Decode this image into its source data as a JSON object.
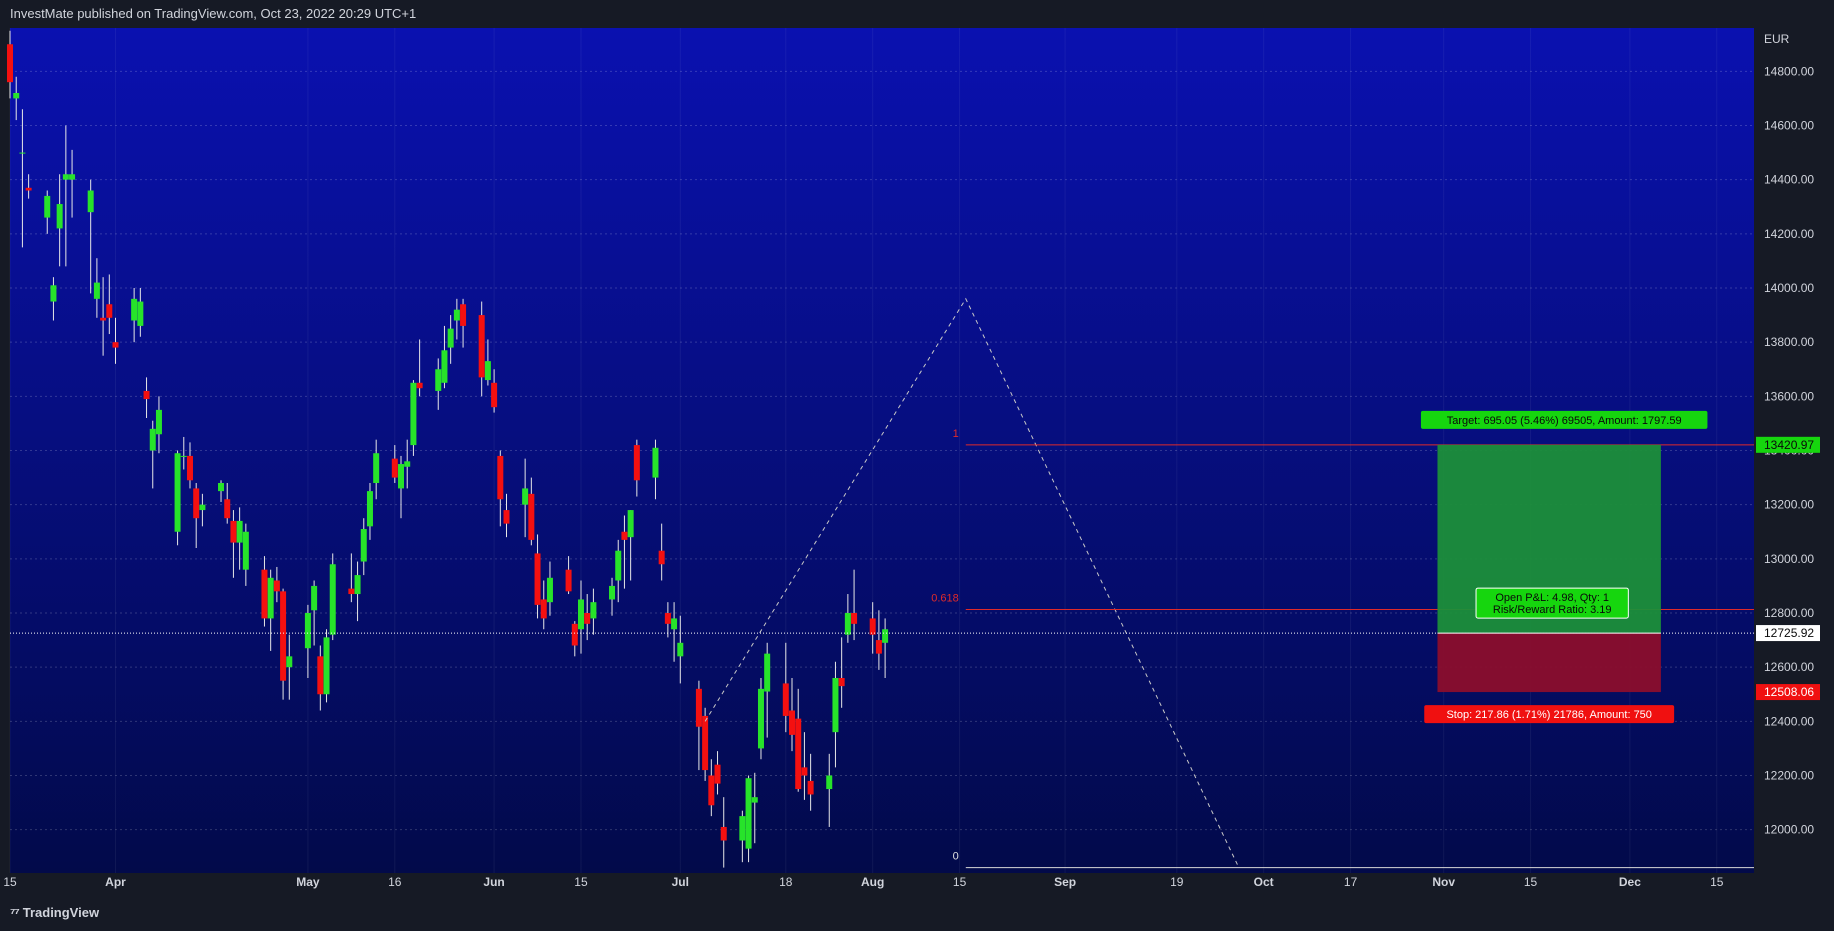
{
  "header": {
    "published_text": "InvestMate published on TradingView.com, Oct 23, 2022 20:29 UTC+1"
  },
  "footer": {
    "logo_icon": "tradingview-logo-icon",
    "logo_mark": "⁷⁷",
    "brand": "TradingView"
  },
  "colors": {
    "background_top": "#0a11b0",
    "background_bottom": "#020a4a",
    "candle_up": "#27e32a",
    "candle_down": "#f41010",
    "fib_line": "#e02a2a",
    "target_fill": "#1c8f3a",
    "stop_fill": "#8b0e2c",
    "label_green": "#16d60e",
    "label_red": "#f01010",
    "axis_text": "#d1d4dc"
  },
  "chart_data": {
    "type": "candlestick",
    "currency_label": "EUR",
    "ylim": [
      11840,
      14960
    ],
    "y_ticks": [
      {
        "value": 12000,
        "label": "12000.00"
      },
      {
        "value": 12200,
        "label": "12200.00"
      },
      {
        "value": 12400,
        "label": "12400.00"
      },
      {
        "value": 12600,
        "label": "12600.00"
      },
      {
        "value": 12800,
        "label": "12800.00"
      },
      {
        "value": 13000,
        "label": "13000.00"
      },
      {
        "value": 13200,
        "label": "13200.00"
      },
      {
        "value": 13400,
        "label": "13400.00"
      },
      {
        "value": 13600,
        "label": "13600.00"
      },
      {
        "value": 13800,
        "label": "13800.00"
      },
      {
        "value": 14000,
        "label": "14000.00"
      },
      {
        "value": 14200,
        "label": "14200.00"
      },
      {
        "value": 14400,
        "label": "14400.00"
      },
      {
        "value": 14600,
        "label": "14600.00"
      },
      {
        "value": 14800,
        "label": "14800.00"
      }
    ],
    "x_start": "2022-03-15",
    "x_end": "2022-12-21",
    "x_ticks": [
      {
        "date": "2022-03-15",
        "label": "15"
      },
      {
        "date": "2022-04-01",
        "label": "Apr"
      },
      {
        "date": "2022-05-02",
        "label": "May"
      },
      {
        "date": "2022-05-16",
        "label": "16"
      },
      {
        "date": "2022-06-01",
        "label": "Jun"
      },
      {
        "date": "2022-06-15",
        "label": "15"
      },
      {
        "date": "2022-07-01",
        "label": "Jul"
      },
      {
        "date": "2022-07-18",
        "label": "18"
      },
      {
        "date": "2022-08-01",
        "label": "Aug"
      },
      {
        "date": "2022-08-15",
        "label": "15"
      },
      {
        "date": "2022-09-01",
        "label": "Sep"
      },
      {
        "date": "2022-09-19",
        "label": "19"
      },
      {
        "date": "2022-10-03",
        "label": "Oct"
      },
      {
        "date": "2022-10-17",
        "label": "17"
      },
      {
        "date": "2022-11-01",
        "label": "Nov"
      },
      {
        "date": "2022-11-15",
        "label": "15"
      },
      {
        "date": "2022-12-01",
        "label": "Dec"
      },
      {
        "date": "2022-12-15",
        "label": "15"
      }
    ],
    "candles_ohlc": [
      [
        14900,
        14950,
        14700,
        14760
      ],
      [
        14700,
        14780,
        14620,
        14720
      ],
      [
        14500,
        14660,
        14150,
        14500
      ],
      [
        14370,
        14420,
        14330,
        14360
      ],
      [
        14260,
        14360,
        14200,
        14340
      ],
      [
        13950,
        14040,
        13880,
        14010
      ],
      [
        14220,
        14420,
        14080,
        14310
      ],
      [
        14400,
        14600,
        14080,
        14420
      ],
      [
        14400,
        14510,
        14260,
        14420
      ],
      [
        14280,
        14400,
        13980,
        14360
      ],
      [
        13960,
        14110,
        13890,
        14020
      ],
      [
        13890,
        14040,
        13750,
        13880
      ],
      [
        13940,
        14050,
        13830,
        13890
      ],
      [
        13800,
        13890,
        13720,
        13780
      ],
      [
        13880,
        14000,
        13800,
        13960
      ],
      [
        13860,
        14000,
        13820,
        13950
      ],
      [
        13620,
        13670,
        13520,
        13590
      ],
      [
        13400,
        13510,
        13260,
        13480
      ],
      [
        13460,
        13600,
        13390,
        13550
      ],
      [
        13100,
        13400,
        13050,
        13390
      ],
      [
        13380,
        13450,
        13330,
        13380
      ],
      [
        13380,
        13430,
        13260,
        13290
      ],
      [
        13260,
        13280,
        13040,
        13150
      ],
      [
        13180,
        13240,
        13120,
        13200
      ],
      [
        13250,
        13290,
        13210,
        13280
      ],
      [
        13220,
        13280,
        13130,
        13150
      ],
      [
        13140,
        13180,
        12930,
        13060
      ],
      [
        13060,
        13190,
        12960,
        13140
      ],
      [
        12960,
        13130,
        12900,
        13100
      ],
      [
        12960,
        13010,
        12750,
        12780
      ],
      [
        12780,
        12960,
        12660,
        12930
      ],
      [
        12920,
        12970,
        12840,
        12880
      ],
      [
        12880,
        12890,
        12480,
        12550
      ],
      [
        12600,
        12720,
        12480,
        12640
      ],
      [
        12670,
        12830,
        12560,
        12800
      ],
      [
        12810,
        12920,
        12680,
        12900
      ],
      [
        12640,
        12680,
        12440,
        12500
      ],
      [
        12500,
        12740,
        12470,
        12710
      ],
      [
        12720,
        13020,
        12700,
        12980
      ],
      [
        12890,
        13020,
        12840,
        12870
      ],
      [
        12870,
        12990,
        12770,
        12940
      ],
      [
        12990,
        13150,
        12940,
        13110
      ],
      [
        13120,
        13280,
        13070,
        13250
      ],
      [
        13280,
        13440,
        13220,
        13390
      ],
      [
        13370,
        13420,
        13280,
        13300
      ],
      [
        13260,
        13380,
        13150,
        13350
      ],
      [
        13340,
        13440,
        13260,
        13360
      ],
      [
        13420,
        13660,
        13380,
        13650
      ],
      [
        13650,
        13810,
        13600,
        13630
      ],
      [
        13620,
        13740,
        13550,
        13700
      ],
      [
        13650,
        13860,
        13630,
        13770
      ],
      [
        13780,
        13900,
        13720,
        13850
      ],
      [
        13880,
        13960,
        13810,
        13920
      ],
      [
        13940,
        13960,
        13780,
        13860
      ],
      [
        13900,
        13950,
        13600,
        13670
      ],
      [
        13660,
        13810,
        13640,
        13730
      ],
      [
        13650,
        13700,
        13540,
        13560
      ],
      [
        13380,
        13400,
        13120,
        13220
      ],
      [
        13180,
        13240,
        13080,
        13130
      ],
      [
        13200,
        13370,
        13080,
        13260
      ],
      [
        13240,
        13300,
        13050,
        13070
      ],
      [
        13020,
        13090,
        12780,
        12830
      ],
      [
        12850,
        12920,
        12740,
        12780
      ],
      [
        12840,
        12990,
        12790,
        12930
      ],
      [
        12960,
        13010,
        12870,
        12880
      ],
      [
        12760,
        12770,
        12640,
        12680
      ],
      [
        12740,
        12920,
        12650,
        12850
      ],
      [
        12800,
        12870,
        12700,
        12760
      ],
      [
        12780,
        12890,
        12720,
        12840
      ],
      [
        12850,
        12930,
        12790,
        12900
      ],
      [
        12920,
        13070,
        12840,
        13030
      ],
      [
        13100,
        13160,
        12890,
        13070
      ],
      [
        13080,
        13180,
        12920,
        13180
      ],
      [
        13420,
        13440,
        13230,
        13290
      ],
      [
        13300,
        13440,
        13220,
        13410
      ],
      [
        13030,
        13130,
        12920,
        12980
      ],
      [
        12800,
        12840,
        12710,
        12760
      ],
      [
        12740,
        12840,
        12620,
        12780
      ],
      [
        12640,
        12790,
        12540,
        12690
      ],
      [
        12520,
        12550,
        12220,
        12380
      ],
      [
        12420,
        12450,
        12180,
        12220
      ],
      [
        12200,
        12260,
        12050,
        12090
      ],
      [
        12240,
        12290,
        12130,
        12170
      ],
      [
        12010,
        12120,
        11860,
        11960
      ],
      [
        11960,
        12070,
        11880,
        12050
      ],
      [
        11930,
        12200,
        11880,
        12190
      ],
      [
        12100,
        12210,
        11950,
        12120
      ],
      [
        12300,
        12560,
        12260,
        12520
      ],
      [
        12510,
        12690,
        12340,
        12650
      ],
      [
        12540,
        12690,
        12360,
        12420
      ],
      [
        12440,
        12560,
        12290,
        12350
      ],
      [
        12410,
        12520,
        12140,
        12150
      ],
      [
        12230,
        12360,
        12110,
        12200
      ],
      [
        12180,
        12280,
        12070,
        12130
      ],
      [
        12150,
        12280,
        12010,
        12200
      ],
      [
        12360,
        12620,
        12230,
        12560
      ],
      [
        12560,
        12710,
        12450,
        12530
      ],
      [
        12720,
        12870,
        12690,
        12800
      ],
      [
        12800,
        12960,
        12700,
        12760
      ],
      [
        12780,
        12840,
        12650,
        12720
      ],
      [
        12700,
        12810,
        12590,
        12650
      ],
      [
        12690,
        12780,
        12560,
        12740
      ]
    ],
    "annotations": {
      "fib_levels": [
        {
          "ratio_label": "1",
          "value": 13420.97
        },
        {
          "ratio_label": "0.618",
          "value": 12813
        },
        {
          "ratio_label": "0",
          "value": 11860
        }
      ],
      "zigzag_points": [
        {
          "date": "2022-07-05",
          "value": 12400
        },
        {
          "date": "2022-08-16",
          "value": 13960
        },
        {
          "date": "2022-09-29",
          "value": 11860
        }
      ],
      "current_price": {
        "value": 12725.92,
        "label": "12725.92"
      },
      "position": {
        "start_date": "2022-10-31",
        "end_date": "2022-12-06",
        "entry": 12725.92,
        "target_price": 13420.97,
        "target_price_label": "13420.97",
        "stop_price": 12508.06,
        "stop_price_label": "12508.06",
        "target_label": "Target: 695.05 (5.46%) 69505, Amount: 1797.59",
        "stop_label": "Stop: 217.86 (1.71%) 21786, Amount: 750",
        "pnl_label": "Open P&L: 4.98, Qty: 1",
        "rr_label": "Risk/Reward Ratio: 3.19"
      }
    }
  }
}
